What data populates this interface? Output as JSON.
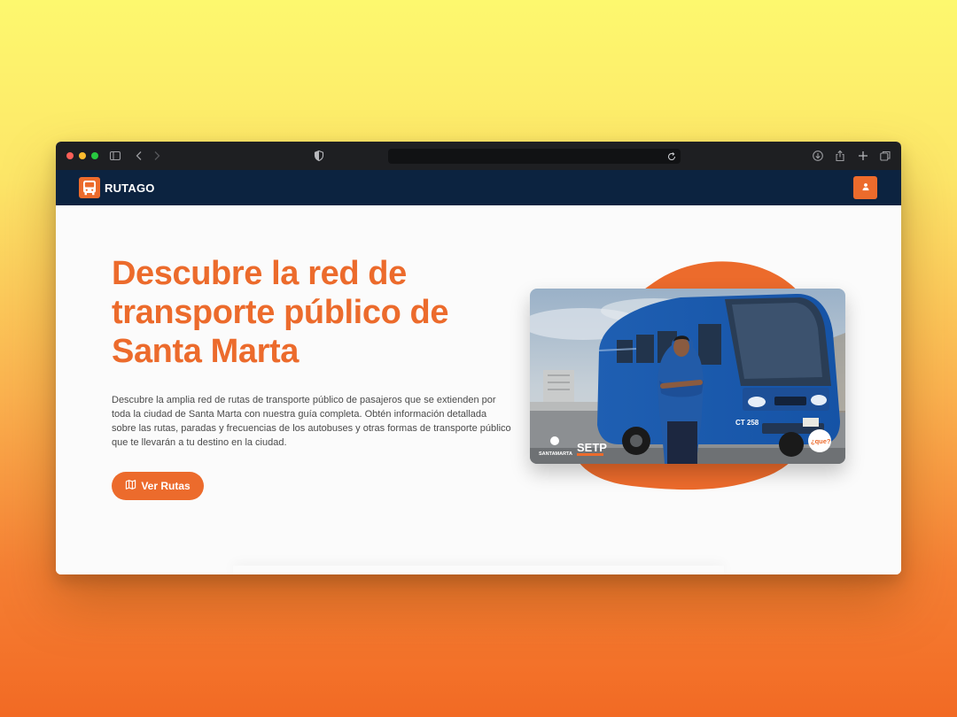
{
  "navbar": {
    "brand": "RUTAGO",
    "brand_color": "#ec6b2c",
    "background": "#0c2340",
    "icons": {
      "logo": "bus-icon",
      "user": "user-icon"
    }
  },
  "browser": {
    "icons": [
      "sidebar-icon",
      "back-icon",
      "forward-icon",
      "shield-icon",
      "reload-icon",
      "download-icon",
      "share-icon",
      "new-tab-icon",
      "tabs-icon"
    ]
  },
  "hero": {
    "title": "Descubre la red de transporte público de Santa Marta",
    "description": "Descubre la amplia red de rutas de transporte público de pasajeros que se extienden por toda la ciudad de Santa Marta con nuestra guía completa. Obtén información detallada sobre las rutas, paradas y frecuencias de los autobuses y otras formas de transporte público que te llevarán a tu destino en la ciudad.",
    "cta_label": "Ver Rutas",
    "cta_icon": "map-icon"
  },
  "photo": {
    "bus_plate": "CT 258",
    "logo_left": "SANTAMARTA",
    "logo_right": "SETP",
    "badge": "¿que?"
  }
}
